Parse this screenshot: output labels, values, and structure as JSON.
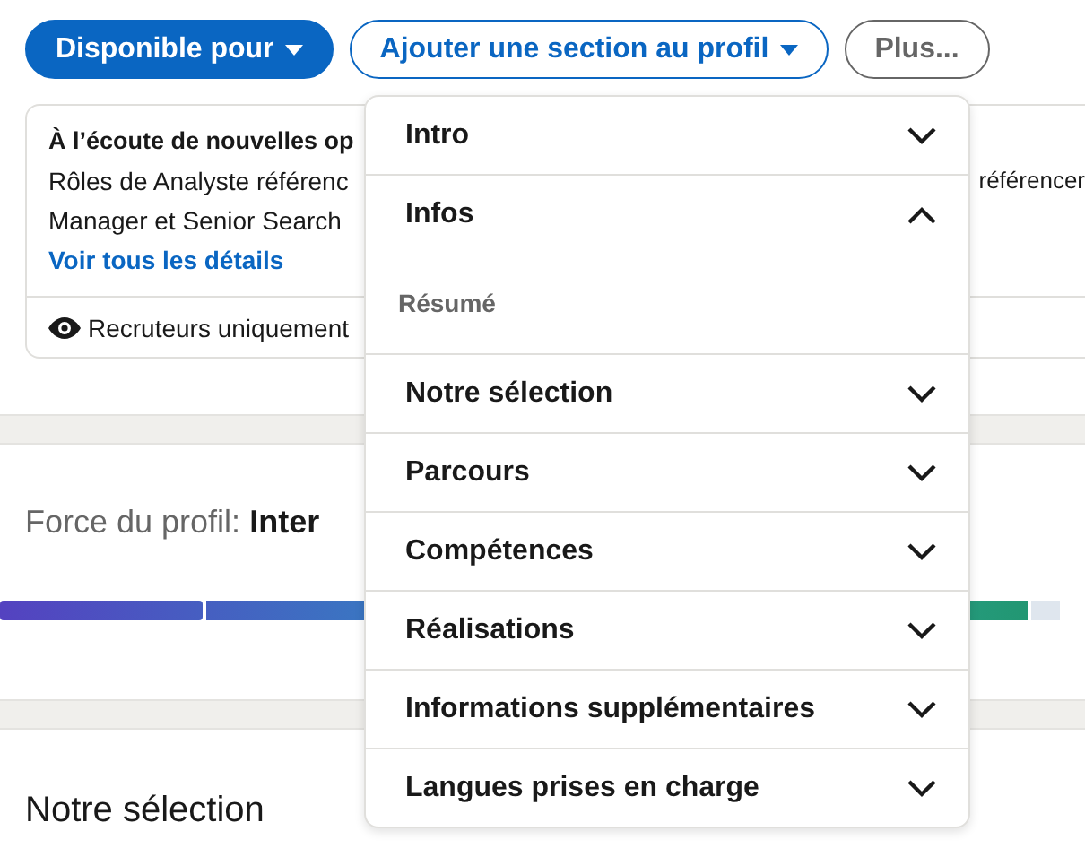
{
  "actions": [
    {
      "label": "Disponible pour",
      "kind": "primary",
      "caret": true
    },
    {
      "label": "Ajouter une section au profil",
      "kind": "outline",
      "caret": true
    },
    {
      "label": "Plus...",
      "kind": "secondary",
      "caret": false
    }
  ],
  "open_to_work": {
    "title": "À l’écoute de nouvelles op",
    "lines": [
      "Rôles de Analyste référenc",
      "Manager et Senior Search"
    ],
    "line_right": "référencer",
    "link": "Voir tous les détails",
    "visibility": "Recruteurs uniquement"
  },
  "profile_strength": {
    "label": "Force du profil:",
    "value": "Inter"
  },
  "section_title": "Notre sélection",
  "menu": [
    {
      "label": "Intro",
      "expanded": false
    },
    {
      "label": "Infos",
      "expanded": true,
      "children": [
        {
          "label": "Résumé"
        }
      ]
    },
    {
      "label": "Notre sélection",
      "expanded": false
    },
    {
      "label": "Parcours",
      "expanded": false
    },
    {
      "label": "Compétences",
      "expanded": false
    },
    {
      "label": "Réalisations",
      "expanded": false
    },
    {
      "label": "Informations supplémentaires",
      "expanded": false
    },
    {
      "label": "Langues prises en charge",
      "expanded": false
    }
  ]
}
